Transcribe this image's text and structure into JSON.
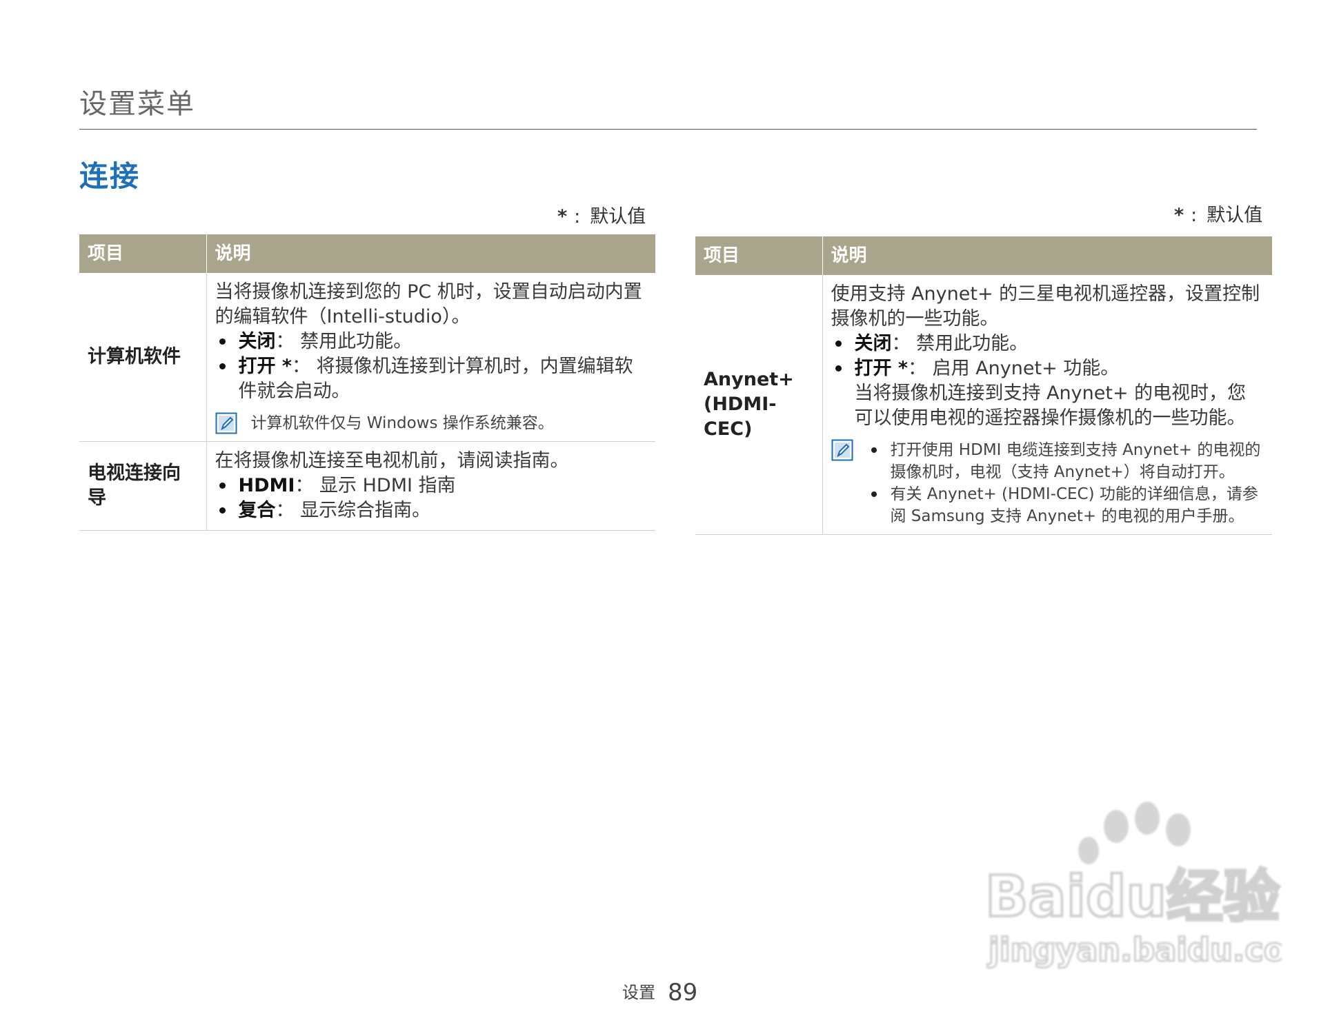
{
  "page": {
    "section_title": "设置菜单",
    "subtitle": "连接"
  },
  "default_note": {
    "star": "*",
    "colon": ":",
    "text": "默认值"
  },
  "table_left": {
    "headers": [
      "项目",
      "说明"
    ],
    "rows": [
      {
        "item": "计算机软件",
        "intro": "当将摄像机连接到您的 PC 机时，设置自动启动内置的编辑软件（Intelli-studio）。",
        "bullets": [
          {
            "label": "关闭",
            "text": "： 禁用此功能。"
          },
          {
            "label": "打开 *",
            "text": "： 将摄像机连接到计算机时，内置编辑软件就会启动。"
          }
        ],
        "note": "计算机软件仅与 Windows 操作系统兼容。"
      },
      {
        "item": "电视连接向导",
        "intro": "在将摄像机连接至电视机前，请阅读指南。",
        "bullets": [
          {
            "label": "HDMI",
            "text": "： 显示 HDMI 指南"
          },
          {
            "label": "复合",
            "text": "： 显示综合指南。"
          }
        ]
      }
    ]
  },
  "table_right": {
    "headers": [
      "项目",
      "说明"
    ],
    "row": {
      "item_line1": "Anynet+",
      "item_line2": "(HDMI-CEC)",
      "intro": "使用支持 Anynet+ 的三星电视机遥控器，设置控制摄像机的一些功能。",
      "bullets": [
        {
          "label": "关闭",
          "text": "： 禁用此功能。"
        },
        {
          "label": "打开 *",
          "text": "： 启用 Anynet+ 功能。"
        }
      ],
      "continuation": "当将摄像机连接到支持 Anynet+ 的电视时，您可以使用电视的遥控器操作摄像机的一些功能。",
      "notes": [
        "打开使用 HDMI 电缆连接到支持 Anynet+ 的电视的摄像机时，电视（支持 Anynet+）将自动打开。",
        "有关 Anynet+ (HDMI-CEC) 功能的详细信息，请参阅 Samsung 支持 Anynet+ 的电视的用户手册。"
      ]
    }
  },
  "footer": {
    "label": "设置",
    "page_number": "89"
  },
  "watermark": {
    "text_main": "Baidu经验",
    "text_url": "jingyan.baidu.com"
  },
  "colors": {
    "header_bg": "#a9a48c",
    "subtitle": "#1d6fb8",
    "note_icon": "#1d6fb8"
  },
  "icons": {
    "note": "note-pencil-icon"
  }
}
